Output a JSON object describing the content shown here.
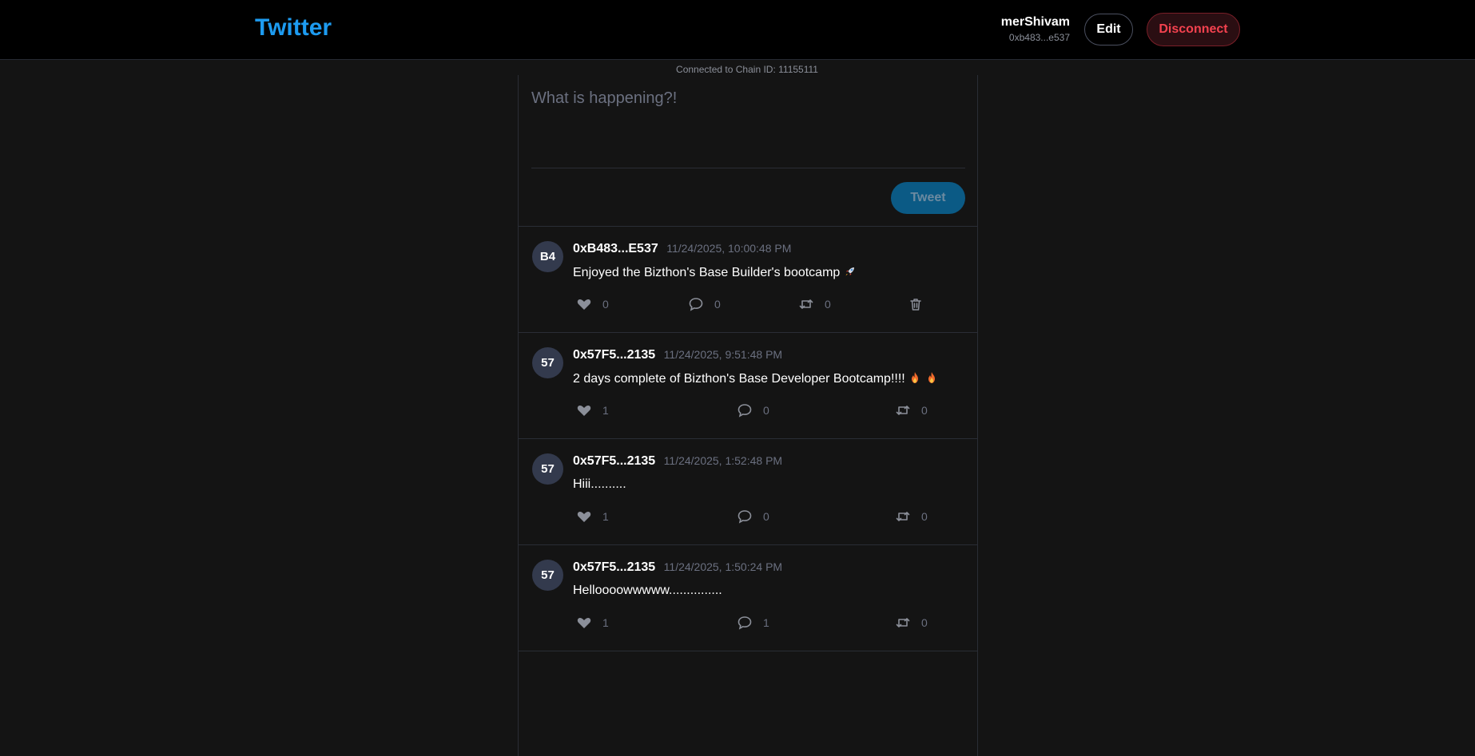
{
  "header": {
    "brand": "Twitter",
    "user_name": "merShivam",
    "user_address": "0xb483...e537",
    "edit_label": "Edit",
    "disconnect_label": "Disconnect"
  },
  "chain_info": "Connected to Chain ID: 11155111",
  "composer": {
    "placeholder": "What is happening?!",
    "tweet_label": "Tweet"
  },
  "posts": [
    {
      "avatar": "B4",
      "author": "0xB483...E537",
      "time": "11/24/2025, 10:00:48 PM",
      "text": "Enjoyed the Bizthon's Base Builder's bootcamp",
      "emoji": "rocket-icon",
      "likes": "0",
      "comments": "0",
      "retweets": "0",
      "deletable": true
    },
    {
      "avatar": "57",
      "author": "0x57F5...2135",
      "time": "11/24/2025, 9:51:48 PM",
      "text": "2 days complete of Bizthon's Base Developer Bootcamp!!!!",
      "emoji": "fire-icon",
      "likes": "1",
      "comments": "0",
      "retweets": "0",
      "deletable": false
    },
    {
      "avatar": "57",
      "author": "0x57F5...2135",
      "time": "11/24/2025, 1:52:48 PM",
      "text": "Hiii..........",
      "likes": "1",
      "comments": "0",
      "retweets": "0",
      "deletable": false
    },
    {
      "avatar": "57",
      "author": "0x57F5...2135",
      "time": "11/24/2025, 1:50:24 PM",
      "text": "Helloooowwwww...............",
      "likes": "1",
      "comments": "1",
      "retweets": "0",
      "deletable": false
    }
  ],
  "colors": {
    "brand": "#1d9bf0",
    "disconnect": "#f4424f",
    "tweet_button": "#0b5a85",
    "background": "#141414"
  }
}
